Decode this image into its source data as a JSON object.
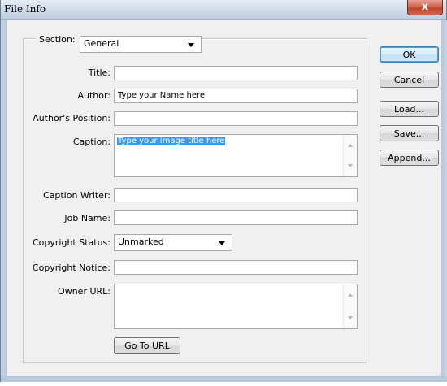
{
  "window": {
    "title": "File Info",
    "close_glyph": "x"
  },
  "section": {
    "label": "Section:",
    "value": "General"
  },
  "fields": {
    "title": {
      "label": "Title:",
      "value": ""
    },
    "author": {
      "label": "Author:",
      "value": "Type your Name here"
    },
    "author_position": {
      "label": "Author's Position:",
      "value": ""
    },
    "caption": {
      "label": "Caption:",
      "value": "Type your image title here"
    },
    "caption_writer": {
      "label": "Caption Writer:",
      "value": ""
    },
    "job_name": {
      "label": "Job Name:",
      "value": ""
    },
    "copyright_status": {
      "label": "Copyright Status:",
      "value": "Unmarked"
    },
    "copyright_notice": {
      "label": "Copyright Notice:",
      "value": ""
    },
    "owner_url": {
      "label": "Owner URL:",
      "value": ""
    }
  },
  "buttons": {
    "go_to_url": "Go To URL",
    "ok": "OK",
    "cancel": "Cancel",
    "load": "Load...",
    "save": "Save...",
    "append": "Append..."
  },
  "icons": {
    "close": "close-icon",
    "dropdown": "chevron-down-icon",
    "scroll_up": "scroll-up-arrow-icon",
    "scroll_down": "scroll-down-arrow-icon"
  }
}
